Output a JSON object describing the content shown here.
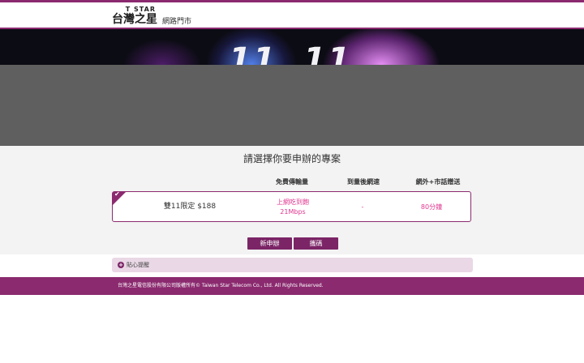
{
  "brand": {
    "logo_en": "T STAR",
    "logo_zh": "台灣之星",
    "store_name": "網路門市",
    "accent_color": "#8b2a6f",
    "highlight_color": "#e0368f"
  },
  "banner": {
    "digits_left": "11",
    "digits_right": "11"
  },
  "main": {
    "heading": "請選擇你要申辦的專案",
    "columns": [
      "免費傳輸量",
      "到量後網速",
      "網外+市話贈送"
    ],
    "plan": {
      "name": "雙11限定 $188",
      "data_line1": "上網吃到飽",
      "data_line2": "21Mbps",
      "speed_after": "-",
      "free_minutes": "80分鐘",
      "selected": true
    },
    "buttons": {
      "new_apply": "新申辦",
      "port_in": "攜碼"
    }
  },
  "notice": {
    "label": "貼心提醒"
  },
  "footer": {
    "copyright": "台灣之星電信股份有限公司版權所有© Taiwan Star Telecom Co., Ltd. All Rights Reserved."
  }
}
